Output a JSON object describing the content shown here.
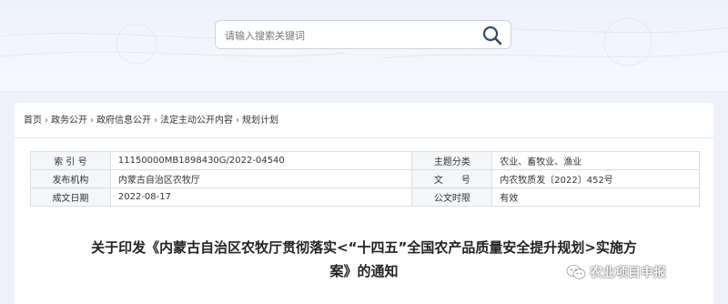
{
  "search": {
    "placeholder": "请输入搜索关键词",
    "icon": "search-icon"
  },
  "breadcrumb": {
    "items": [
      "首页",
      "政务公开",
      "政府信息公开",
      "法定主动公开内容",
      "规划计划"
    ],
    "separator": "›"
  },
  "meta": {
    "index_label": "索 引 号",
    "index_value": "11150000MB1898430G/2022-04540",
    "topic_label": "主题分类",
    "topic_value": "农业、畜牧业、渔业",
    "publisher_label": "发布机构",
    "publisher_value": "内蒙古自治区农牧厅",
    "doc_label": "文　　号",
    "doc_value": "内农牧质发〔2022〕452号",
    "date_label": "成文日期",
    "date_value": "2022-08-17",
    "validity_label": "公文时限",
    "validity_value": "有效"
  },
  "title": {
    "line1": "关于印发《内蒙古自治区农牧厅贯彻落实<“十四五”全国农产品质量安全提升规划>实施方",
    "line2": "案》的通知"
  },
  "watermark": {
    "text": "农业项目申报",
    "icon": "wechat-icon"
  },
  "colors": {
    "page_bg": "#eef2f8",
    "table_border": "#d7dde6",
    "label_bg": "#f5f6f8",
    "search_icon": "#2e4a74"
  }
}
